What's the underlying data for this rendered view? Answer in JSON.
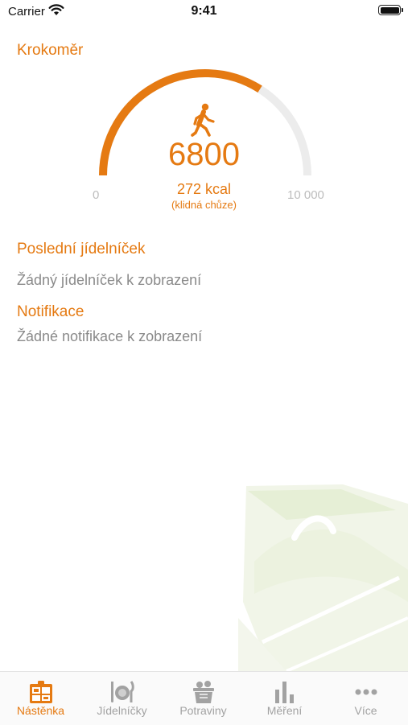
{
  "status_bar": {
    "carrier": "Carrier",
    "time": "9:41",
    "wifi_icon": "wifi-icon",
    "battery_icon": "battery-icon"
  },
  "pedometer": {
    "title": "Krokoměr",
    "steps": "6800",
    "steps_fraction": 0.68,
    "kcal": "272 kcal",
    "activity": "(klidná chůze)",
    "min_label": "0",
    "max_label": "10 000",
    "icon": "walking-person-icon"
  },
  "last_menu": {
    "title": "Poslední jídelníček",
    "empty_text": "Žádný jídelníček k zobrazení"
  },
  "notifications": {
    "title": "Notifikace",
    "empty_text": "Žádné notifikace k zobrazení"
  },
  "tabs": [
    {
      "label": "Nástěnka",
      "icon": "dashboard-icon",
      "active": true
    },
    {
      "label": "Jídelníčky",
      "icon": "plate-cutlery-icon",
      "active": false
    },
    {
      "label": "Potraviny",
      "icon": "grocery-basket-icon",
      "active": false
    },
    {
      "label": "Měření",
      "icon": "bar-chart-icon",
      "active": false
    },
    {
      "label": "Více",
      "icon": "more-dots-icon",
      "active": false
    }
  ],
  "colors": {
    "accent": "#e57a12",
    "muted_text": "#8a8a8a",
    "gauge_track": "#ececec",
    "tab_inactive": "#a2a2a2"
  }
}
